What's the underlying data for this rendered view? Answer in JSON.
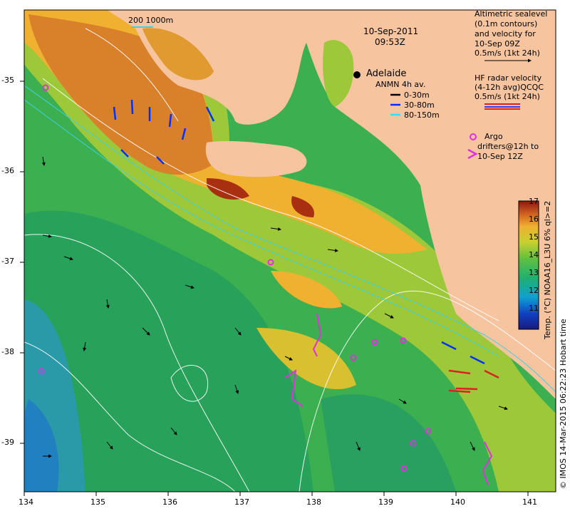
{
  "map": {
    "date_label": "10-Sep-2011",
    "time_label": "09:53Z",
    "scale_bar_label": "200  1000m",
    "city": "Adelaide",
    "lon_ticks": [
      "134",
      "135",
      "136",
      "137",
      "138",
      "139",
      "140",
      "141"
    ],
    "lat_ticks": [
      "-35",
      "-36",
      "-37",
      "-38",
      "-39"
    ],
    "colors": {
      "land": "#f6c49e",
      "cool_sea": "#22aa44",
      "warm_sea": "#f0b030",
      "hot_sea": "#a83010",
      "contour": "#ffffff",
      "isobath": "#40d0e0"
    }
  },
  "legend": {
    "altimetry": {
      "line1": "Altimetric sealevel",
      "line2": "(0.1m contours)",
      "line3": "and velocity for",
      "line4": "10-Sep 09Z",
      "scale": "0.5m/s (1kt 24h)"
    },
    "hf_radar": {
      "line1": "HF radar velocity",
      "line2": "(4-12h avg)QCQC",
      "scale": "0.5m/s (1kt 24h)"
    },
    "anmn": {
      "title": "ANMN 4h av.",
      "depth1": "0-30m",
      "depth2": "30-80m",
      "depth3": "80-150m",
      "color1": "#000000",
      "color2": "#0030ff",
      "color3": "#30e0ff"
    },
    "argo": {
      "line1": "Argo",
      "line2": "drifters@12h to",
      "line3": "10-Sep 12Z"
    }
  },
  "colorbar": {
    "ticks": [
      "17",
      "16",
      "15",
      "14",
      "13",
      "12",
      "11"
    ],
    "label": "Temp. (°C) NOAA16_L3U 6% ql>=2"
  },
  "credit": "© IMOS 14-Mar-2015 06:22:23 Hobart time"
}
